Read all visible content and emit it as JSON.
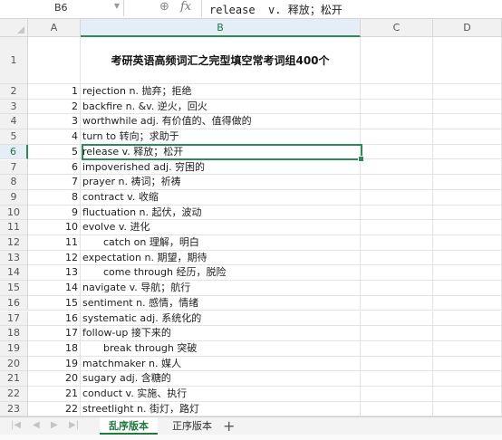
{
  "formula_bar": {
    "cell_ref": "B6",
    "fx_label": "fx",
    "content": "release  v. 释放；松开"
  },
  "columns": [
    "A",
    "B",
    "C",
    "D"
  ],
  "active_column": "B",
  "title": "考研英语高频词汇之完型填空常考词组400个",
  "title_row": "1",
  "rows": [
    {
      "row": "2",
      "num": "1",
      "text": "rejection n. 抛弃；拒绝",
      "indent": false
    },
    {
      "row": "3",
      "num": "2",
      "text": "backfire  n. &v. 逆火，回火",
      "indent": false
    },
    {
      "row": "4",
      "num": "3",
      "text": "worthwhile adj. 有价值的、值得做的",
      "indent": false
    },
    {
      "row": "5",
      "num": "4",
      "text": "turn to 转向；求助于",
      "indent": false
    },
    {
      "row": "6",
      "num": "5",
      "text": "release v. 释放；松开",
      "indent": false
    },
    {
      "row": "7",
      "num": "6",
      "text": "impoverished adj. 穷困的",
      "indent": false
    },
    {
      "row": "8",
      "num": "7",
      "text": "prayer n. 祷词；祈祷",
      "indent": false
    },
    {
      "row": "9",
      "num": "8",
      "text": "contract  v. 收缩",
      "indent": false
    },
    {
      "row": "10",
      "num": "9",
      "text": "fluctuation   n. 起伏，波动",
      "indent": false
    },
    {
      "row": "11",
      "num": "10",
      "text": "evolve v. 进化",
      "indent": false
    },
    {
      "row": "12",
      "num": "11",
      "text": "catch on 理解，明白",
      "indent": true
    },
    {
      "row": "13",
      "num": "12",
      "text": "expectation   n. 期望，期待",
      "indent": false
    },
    {
      "row": "14",
      "num": "13",
      "text": "come through 经历，脱险",
      "indent": true
    },
    {
      "row": "15",
      "num": "14",
      "text": "navigate v. 导航；航行",
      "indent": false
    },
    {
      "row": "16",
      "num": "15",
      "text": "sentiment   n. 感情，情绪",
      "indent": false
    },
    {
      "row": "17",
      "num": "16",
      "text": "systematic adj. 系统化的",
      "indent": false
    },
    {
      "row": "18",
      "num": "17",
      "text": "follow-up 接下来的",
      "indent": false
    },
    {
      "row": "19",
      "num": "18",
      "text": "break through 突破",
      "indent": true
    },
    {
      "row": "20",
      "num": "19",
      "text": "matchmaker n. 媒人",
      "indent": false
    },
    {
      "row": "21",
      "num": "20",
      "text": "sugary  adj. 含糖的",
      "indent": false
    },
    {
      "row": "22",
      "num": "21",
      "text": "conduct v. 实施、执行",
      "indent": false
    },
    {
      "row": "23",
      "num": "22",
      "text": "streetlight n. 街灯，路灯",
      "indent": false
    }
  ],
  "active_row": "6",
  "sheet_tabs": [
    {
      "label": "乱序版本",
      "active": true
    },
    {
      "label": "正序版本",
      "active": false
    }
  ],
  "add_tab_label": "+",
  "colors": {
    "accent_green": "#2e8b57",
    "tab_active_green": "#1f7a3c",
    "header_bg": "#f1f1f1",
    "active_header_bg": "#e5eef7"
  }
}
